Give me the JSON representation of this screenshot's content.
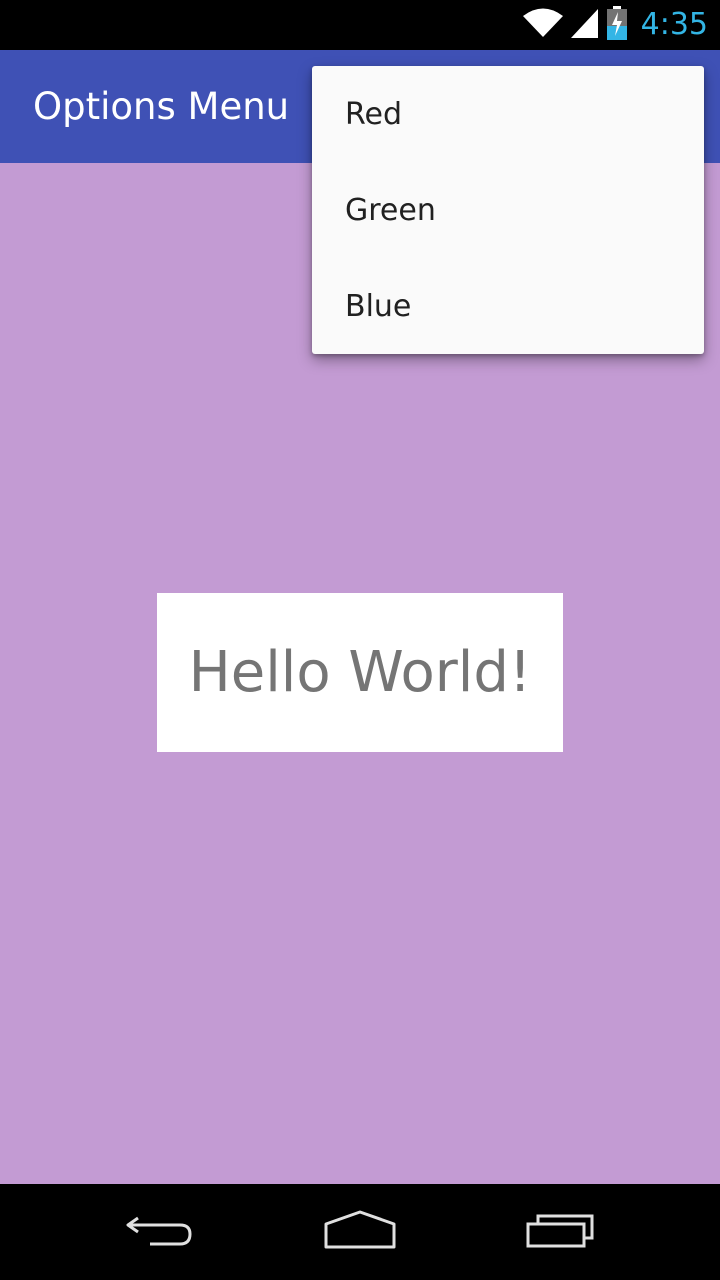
{
  "status_bar": {
    "time": "4:35",
    "icons": [
      "wifi-icon",
      "signal-icon",
      "battery-charging-icon"
    ],
    "time_color": "#33b5e5"
  },
  "app_bar": {
    "title": "Options Menu",
    "color": "#3f51b5"
  },
  "content": {
    "background": "#c39bd3",
    "hello_text": "Hello World!"
  },
  "menu": {
    "items": [
      {
        "label": "Red"
      },
      {
        "label": "Green"
      },
      {
        "label": "Blue"
      }
    ]
  },
  "nav_bar": {
    "buttons": [
      "back-icon",
      "home-icon",
      "recents-icon"
    ]
  }
}
